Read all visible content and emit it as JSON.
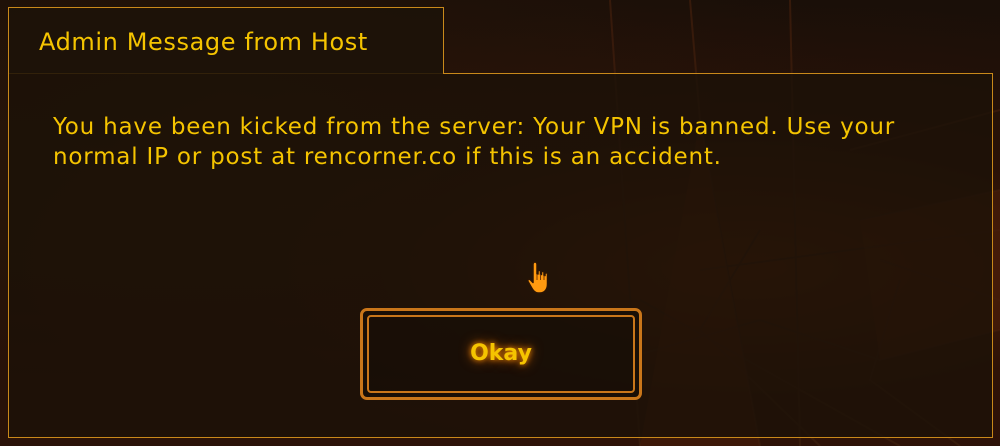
{
  "dialog": {
    "title": "Admin Message from Host",
    "message": "You have been kicked from the server: Your VPN is banned. Use your normal IP or post at rencorner.co if this is an accident.",
    "button_label": "Okay"
  },
  "colors": {
    "text": "#f5c400",
    "border": "#c9891a",
    "button_border": "#c9761a",
    "glow": "#ff9600"
  },
  "icons": {
    "cursor": "hand-pointer-icon"
  }
}
